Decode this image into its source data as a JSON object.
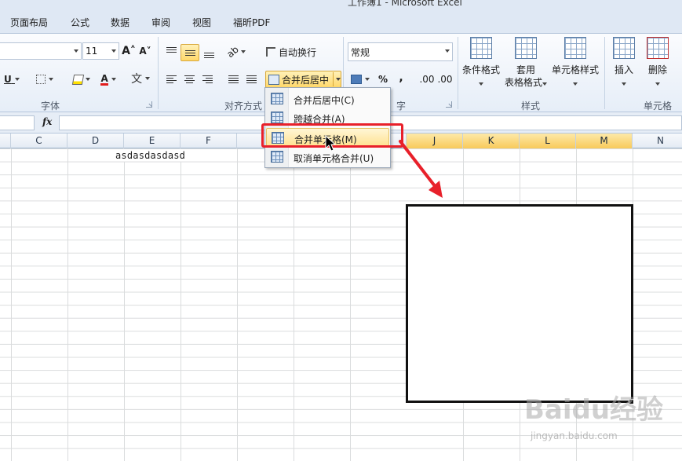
{
  "window": {
    "title": "工作簿1 - Microsoft Excel"
  },
  "tabs": [
    "页面布局",
    "公式",
    "数据",
    "审阅",
    "视图",
    "福昕PDF"
  ],
  "font_group": {
    "label": "字体",
    "font_size": "11",
    "underline": "U",
    "grow_icon": "A˄",
    "shrink_icon": "A˅",
    "font_color_glyph": "A",
    "phonetic_glyph": "文"
  },
  "alignment_group": {
    "label": "对齐方式",
    "wrap_text": "自动换行",
    "merge_center": "合并后居中"
  },
  "number_group": {
    "label": "字",
    "format": "常规",
    "percent": "%",
    "comma": ",",
    "inc_decimal": ".00",
    "dec_decimal": ".00"
  },
  "styles_group": {
    "label": "样式",
    "conditional": "条件格式",
    "table_format_1": "套用",
    "table_format_2": "表格格式",
    "cell_styles": "单元格样式"
  },
  "cells_group": {
    "label": "单元格",
    "insert": "插入",
    "delete": "删除"
  },
  "formula_bar": {
    "fx": "fx",
    "value": ""
  },
  "columns": [
    {
      "label": "C",
      "highlight": false
    },
    {
      "label": "D",
      "highlight": false
    },
    {
      "label": "E",
      "highlight": false
    },
    {
      "label": "F",
      "highlight": false
    },
    {
      "label": "J",
      "highlight": true
    },
    {
      "label": "K",
      "highlight": true
    },
    {
      "label": "L",
      "highlight": true
    },
    {
      "label": "M",
      "highlight": true
    },
    {
      "label": "N",
      "highlight": false
    }
  ],
  "cell_text": "asdasdasdasd",
  "merge_menu": [
    {
      "label": "合并后居中(C)"
    },
    {
      "label": "跨越合并(A)"
    },
    {
      "label": "合并单元格(M)"
    },
    {
      "label": "取消单元格合并(U)"
    }
  ],
  "watermark": {
    "brand": "Baidu经验",
    "url": "jingyan.baidu.com"
  },
  "colors": {
    "highlight_red": "#e8202a",
    "selected_header": "#f8ca5b",
    "ribbon_bg": "#eef3fa"
  }
}
